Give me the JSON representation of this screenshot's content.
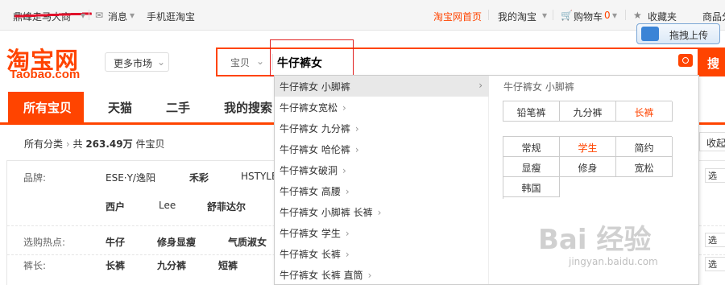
{
  "topbar": {
    "username": "鼎峰走马大商",
    "messages": "消息",
    "mobile": "手机逛淘宝",
    "home": "淘宝网首页",
    "my_taobao": "我的淘宝",
    "cart": "购物车",
    "cart_count": "0",
    "favorites": "收藏夹",
    "goods": "商品分"
  },
  "upload_label": "拖拽上传",
  "logo": {
    "cn": "淘宝网",
    "en": "Taobao.com"
  },
  "market_label": "更多市场",
  "search": {
    "type": "宝贝",
    "query": "牛仔裤女",
    "button": "搜"
  },
  "tabs": [
    "所有宝贝",
    "天猫",
    "二手",
    "我的搜索"
  ],
  "breadcrumb": {
    "root": "所有分类",
    "total_prefix": "共",
    "total": "263.49万",
    "total_suffix": "件宝贝",
    "fold": "收起"
  },
  "filters": {
    "brand_label": "品牌:",
    "brands_row1": [
      "ESE·Y/逸阳",
      "禾彩",
      "HSTYLE"
    ],
    "brands_row2": [
      "西户",
      "Lee",
      "舒菲达尔"
    ],
    "hot_label": "选购热点:",
    "hot": [
      "牛仔",
      "修身显瘦",
      "气质淑女"
    ],
    "length_label": "裤长:",
    "lengths": [
      "长裤",
      "九分裤",
      "短裤"
    ],
    "multi": "选"
  },
  "suggestions": [
    "牛仔裤女 小脚裤",
    "牛仔裤女宽松",
    "牛仔裤女 九分裤",
    "牛仔裤女 哈伦裤",
    "牛仔裤女破洞",
    "牛仔裤女 高腰",
    "牛仔裤女 小脚裤 长裤",
    "牛仔裤女 学生",
    "牛仔裤女 长裤",
    "牛仔裤女 长裤 直筒"
  ],
  "panel": {
    "title": "牛仔裤女 小脚裤",
    "group1": [
      "铅笔裤",
      "九分裤",
      "长裤"
    ],
    "group2": [
      "常规",
      "学生",
      "简约",
      "显瘦",
      "修身",
      "宽松",
      "韩国"
    ]
  },
  "watermark": {
    "main": "Bai 经验",
    "sub": "jingyan.baidu.com"
  },
  "colors": {
    "accent": "#ff4400",
    "highlight_row": "#e8e8e8"
  }
}
